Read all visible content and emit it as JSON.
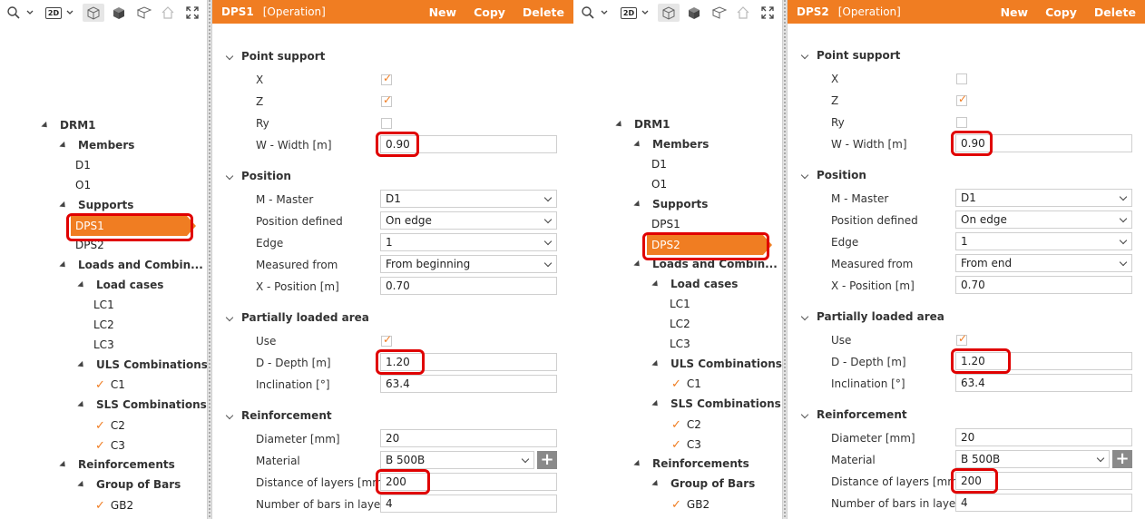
{
  "toolbar": {
    "view_2d_label": "2D"
  },
  "tree": {
    "root": "DRM1",
    "members_label": "Members",
    "members": [
      "D1",
      "O1"
    ],
    "supports_label": "Supports",
    "supports": [
      "DPS1",
      "DPS2"
    ],
    "loads_label": "Loads and Combin...",
    "load_cases_label": "Load cases",
    "load_cases": [
      "LC1",
      "LC2",
      "LC3"
    ],
    "uls_label": "ULS Combinations",
    "uls": [
      "C1"
    ],
    "sls_label": "SLS Combinations",
    "sls": [
      "C2",
      "C3"
    ],
    "reinforcements_label": "Reinforcements",
    "group_of_bars_label": "Group of Bars",
    "group_of_bars": [
      "GB2"
    ]
  },
  "labels": {
    "point_support": "Point support",
    "x": "X",
    "z": "Z",
    "ry": "Ry",
    "width": "W - Width [m]",
    "position": "Position",
    "master": "M - Master",
    "position_defined": "Position defined",
    "edge": "Edge",
    "measured_from": "Measured from",
    "x_position": "X - Position [m]",
    "partially_loaded_area": "Partially loaded area",
    "use": "Use",
    "depth": "D - Depth [m]",
    "inclination": "Inclination [°]",
    "reinforcement": "Reinforcement",
    "diameter": "Diameter [mm]",
    "material": "Material",
    "distance_of_layers": "Distance of layers [mm]",
    "number_of_bars": "Number of bars in layer"
  },
  "header_actions": {
    "new": "New",
    "copy": "Copy",
    "delete": "Delete"
  },
  "left": {
    "header": {
      "name": "DPS1",
      "type": "[Operation]"
    },
    "values": {
      "x_checked": true,
      "z_checked": true,
      "ry_checked": false,
      "width": "0.90",
      "master": "D1",
      "position_defined": "On edge",
      "edge": "1",
      "measured_from": "From beginning",
      "x_position": "0.70",
      "use_checked": true,
      "depth": "1.20",
      "inclination": "63.4",
      "diameter": "20",
      "material": "B 500B",
      "plus": "+",
      "distance_of_layers": "200",
      "number_of_bars": "4"
    }
  },
  "right": {
    "header": {
      "name": "DPS2",
      "type": "[Operation]"
    },
    "values": {
      "x_checked": false,
      "z_checked": true,
      "ry_checked": false,
      "width": "0.90",
      "master": "D1",
      "position_defined": "On edge",
      "edge": "1",
      "measured_from": "From end",
      "x_position": "0.70",
      "use_checked": true,
      "depth": "1.20",
      "inclination": "63.4",
      "diameter": "20",
      "material": "B 500B",
      "plus": "+",
      "distance_of_layers": "200",
      "number_of_bars": "4"
    }
  },
  "colors": {
    "accent": "#f07d22",
    "highlight": "#e00000"
  }
}
